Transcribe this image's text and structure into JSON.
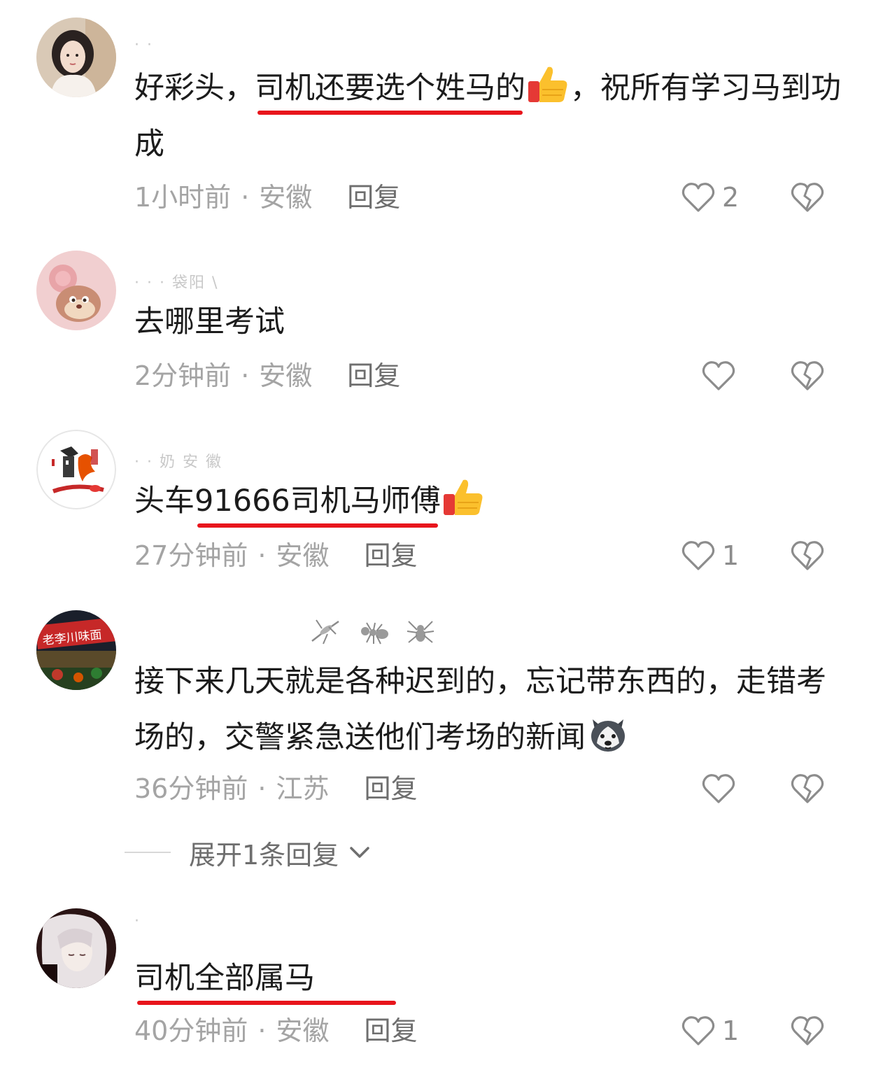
{
  "comments": [
    {
      "username": "· ·",
      "text_parts": [
        "好彩头，",
        "司机还要选个姓马的",
        "",
        "，祝所有学习马到功成"
      ],
      "time": "1小时前",
      "location": "安徽",
      "reply": "回复",
      "likes": "2"
    },
    {
      "username": "· · · 袋阳 \\",
      "text": "去哪里考试",
      "time": "2分钟前",
      "location": "安徽",
      "reply": "回复",
      "likes": ""
    },
    {
      "username": "· · 奶 安 徽",
      "text_parts": [
        "头车",
        "91666司机马师傅",
        ""
      ],
      "time": "27分钟前",
      "location": "安徽",
      "reply": "回复",
      "likes": "1"
    },
    {
      "username": "",
      "text": "接下来几天就是各种迟到的，忘记带东西的，走错考场的，交警紧急送他们考场的新闻",
      "time": "36分钟前",
      "location": "江苏",
      "reply": "回复",
      "likes": "",
      "avatar_text": "老李川味面"
    },
    {
      "username": "·",
      "text": "司机全部属马",
      "time": "40分钟前",
      "location": "安徽",
      "reply": "回复",
      "likes": "1"
    }
  ],
  "expand_replies": "展开1条回复",
  "separator": "·",
  "icons": {
    "like": "heart-outline-icon",
    "dislike": "broken-heart-icon",
    "thumbs": "thumbs-up-emoji",
    "dog": "husky-emoji",
    "expand": "chevron-down-icon"
  },
  "colors": {
    "underline": "#e8151c",
    "meta": "#a4a4a4",
    "text": "#1c1c1c"
  }
}
